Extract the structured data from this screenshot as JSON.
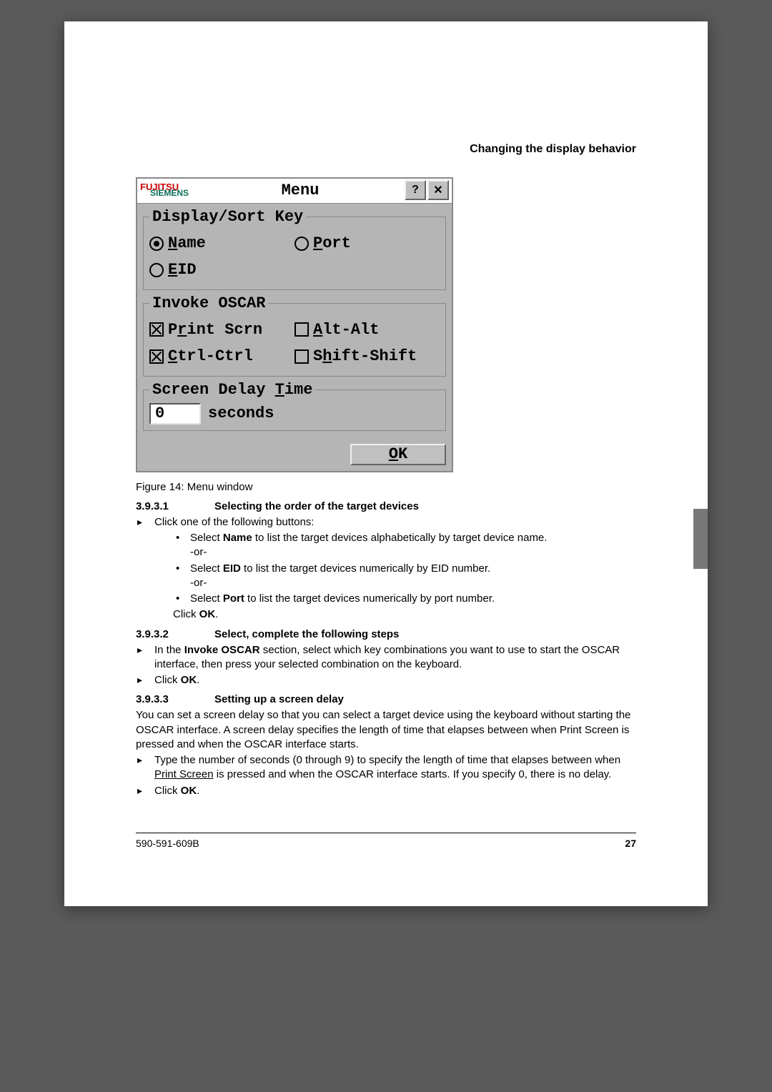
{
  "running_head": "Changing the display behavior",
  "oscar": {
    "brand_top": "FUJITSU",
    "brand_sub": "SIEMENS",
    "title": "Menu",
    "help_glyph": "?",
    "close_glyph": "✕",
    "group_sort": {
      "legend": "Display/Sort Key",
      "name_pre": "",
      "name_ul": "N",
      "name_post": "ame",
      "port_pre": "",
      "port_ul": "P",
      "port_post": "ort",
      "eid_pre": "",
      "eid_ul": "E",
      "eid_post": "ID"
    },
    "group_invoke": {
      "legend": "Invoke OSCAR",
      "print_pre": "P",
      "print_ul": "r",
      "print_post": "int Scrn",
      "alt_pre": "",
      "alt_ul": "A",
      "alt_post": "lt-Alt",
      "ctrl_pre": "",
      "ctrl_ul": "C",
      "ctrl_post": "trl-Ctrl",
      "shift_pre": "S",
      "shift_ul": "h",
      "shift_post": "ift-Shift"
    },
    "group_delay": {
      "legend_pre": "Screen Delay ",
      "legend_ul": "T",
      "legend_post": "ime",
      "value": "0",
      "units": "seconds"
    },
    "ok_ul": "O",
    "ok_post": "K"
  },
  "caption": "Figure 14: Menu window",
  "sec1": {
    "num": "3.9.3.1",
    "title": "Selecting the order of the target devices",
    "click_one": "Click one of the following buttons:",
    "b1a": "Select ",
    "b1b": "Name",
    "b1c": " to list the target devices alphabetically by target device name.",
    "or": "-or-",
    "b2a": "Select ",
    "b2b": "EID",
    "b2c": " to list the target devices numerically by EID number.",
    "b3a": "Select ",
    "b3b": "Port",
    "b3c": " to list the target devices numerically by port number.",
    "click_ok_a": "Click ",
    "click_ok_b": "OK",
    "click_ok_c": "."
  },
  "sec2": {
    "num": "3.9.3.2",
    "title": "Select, complete the following steps",
    "line_a": "In the ",
    "line_b": "Invoke OSCAR",
    "line_c": " section, select which key combinations you want to use to start the OSCAR interface, then press your selected combination on the keyboard.",
    "click_ok_a": "Click ",
    "click_ok_b": "OK",
    "click_ok_c": "."
  },
  "sec3": {
    "num": "3.9.3.3",
    "title": "Setting up a screen delay",
    "para": "You can set a screen delay so that you can select a target device using the keyboard without starting the OSCAR interface. A screen delay specifies the length of time that elapses between when Print Screen is pressed and when the OSCAR interface starts.",
    "step_a": "Type the number of seconds (0 through 9) to specify the length of time that elapses between when ",
    "step_b": "Print Screen",
    "step_c": " is pressed and when the OSCAR interface starts. If you specify 0, there is no delay.",
    "click_ok_a": "Click ",
    "click_ok_b": "OK",
    "click_ok_c": "."
  },
  "footer": {
    "docnum": "590-591-609B",
    "page": "27"
  }
}
